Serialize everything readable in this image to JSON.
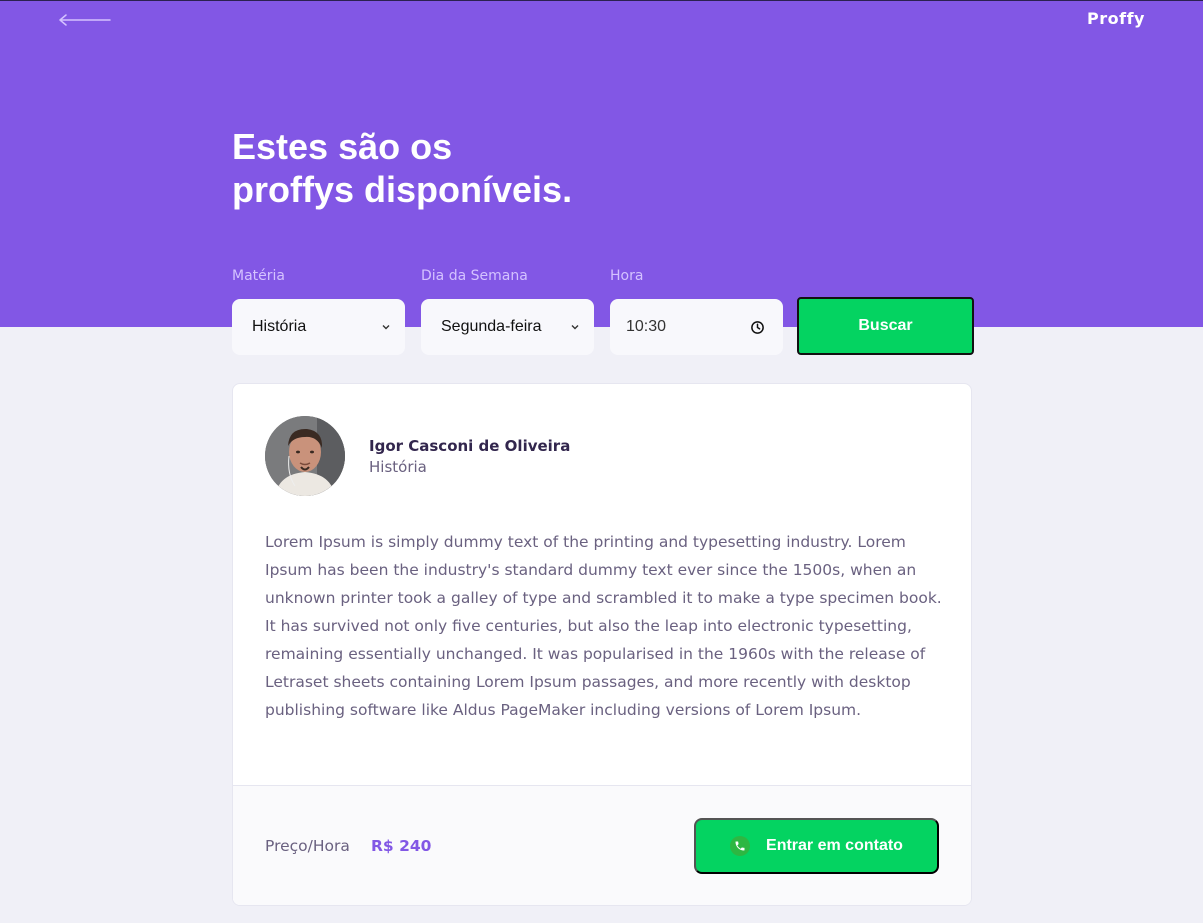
{
  "header": {
    "back_icon": "arrow-left-icon",
    "logo": "Proffy",
    "title_line1": "Estes são os",
    "title_line2": "proffys disponíveis."
  },
  "filters": {
    "subject": {
      "label": "Matéria",
      "value": "História"
    },
    "weekday": {
      "label": "Dia da Semana",
      "value": "Segunda-feira"
    },
    "time": {
      "label": "Hora",
      "value": "10:30",
      "icon": "clock-icon"
    },
    "search_button": "Buscar"
  },
  "teacher": {
    "name": "Igor Casconi de Oliveira",
    "subject": "História",
    "bio": "Lorem Ipsum is simply dummy text of the printing and typesetting industry. Lorem Ipsum has been the industry's standard dummy text ever since the 1500s, when an unknown printer took a galley of type and scrambled it to make a type specimen book. It has survived not only five centuries, but also the leap into electronic typesetting, remaining essentially unchanged. It was popularised in the 1960s with the release of Letraset sheets containing Lorem Ipsum passages, and more recently with desktop publishing software like Aldus PageMaker including versions of Lorem Ipsum.",
    "price_label": "Preço/Hora",
    "price_value": "R$ 240",
    "contact_button": "Entrar em contato",
    "contact_icon": "whatsapp-icon"
  },
  "colors": {
    "primary": "#8257E5",
    "secondary": "#04D361",
    "background": "#F0F0F7"
  }
}
